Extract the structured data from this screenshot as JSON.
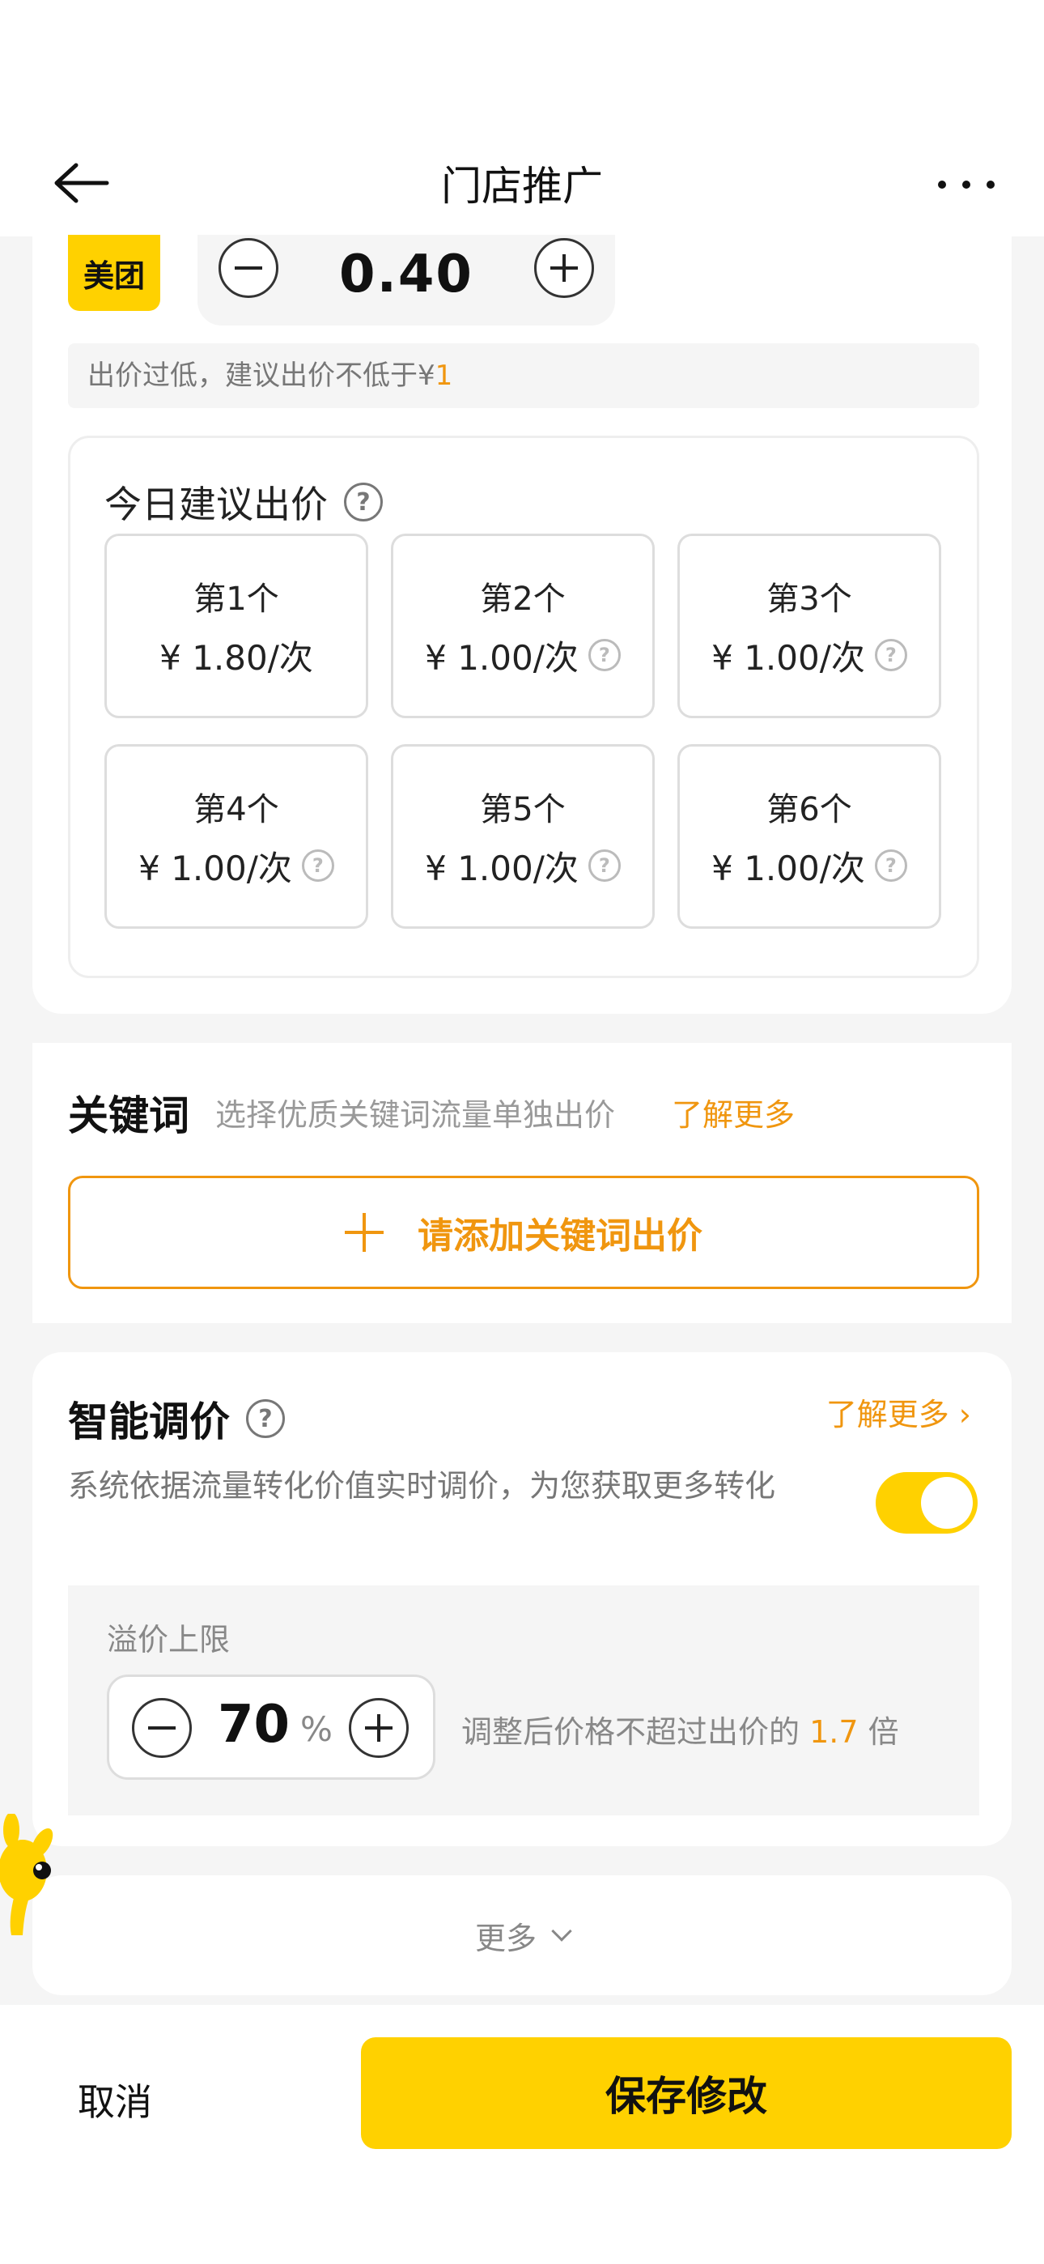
{
  "nav": {
    "title": "门店推广"
  },
  "bid": {
    "brand": "美团",
    "value": "0.40",
    "warning_prefix": "出价过低，建议出价不低于¥",
    "warning_value": "1"
  },
  "suggest": {
    "title": "今日建议出价",
    "help": "?",
    "items": [
      {
        "rank": "第1个",
        "price": "¥ 1.80/次",
        "has_help": false
      },
      {
        "rank": "第2个",
        "price": "¥ 1.00/次",
        "has_help": true
      },
      {
        "rank": "第3个",
        "price": "¥ 1.00/次",
        "has_help": true
      },
      {
        "rank": "第4个",
        "price": "¥ 1.00/次",
        "has_help": true
      },
      {
        "rank": "第5个",
        "price": "¥ 1.00/次",
        "has_help": true
      },
      {
        "rank": "第6个",
        "price": "¥ 1.00/次",
        "has_help": true
      }
    ]
  },
  "keywords": {
    "title": "关键词",
    "desc": "选择优质关键词流量单独出价",
    "link": "了解更多",
    "add_label": "请添加关键词出价"
  },
  "smart": {
    "title": "智能调价",
    "help": "?",
    "link": "了解更多 ›",
    "desc": "系统依据流量转化价值实时调价，为您获取更多转化",
    "toggle_on": true,
    "cap_label": "溢价上限",
    "cap_value": "70",
    "cap_unit": "%",
    "note_prefix": "调整后价格不超过出价的 ",
    "note_value": "1.7",
    "note_suffix": " 倍"
  },
  "more": {
    "label": "更多"
  },
  "footer": {
    "cancel": "取消",
    "save": "保存修改"
  },
  "colors": {
    "accent": "#ffd100",
    "link": "#f0960f"
  }
}
